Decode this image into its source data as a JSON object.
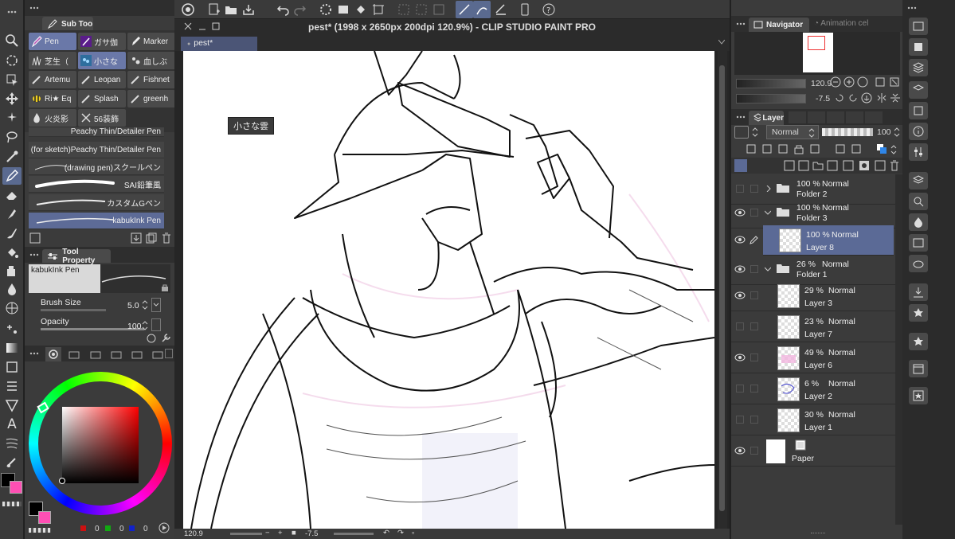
{
  "subtool": {
    "tab_label": "Sub Too",
    "buttons": [
      {
        "label": "Pen"
      },
      {
        "label": "ガサ伽"
      },
      {
        "label": "Marker"
      },
      {
        "label": "芝生（"
      },
      {
        "label": "小さな"
      },
      {
        "label": "血しぶ"
      },
      {
        "label": "Artemu"
      },
      {
        "label": "Leopan"
      },
      {
        "label": "Fishnet"
      },
      {
        "label": "Ri★ Eq"
      },
      {
        "label": "Splash"
      },
      {
        "label": "greenh"
      },
      {
        "label": "火炎影"
      },
      {
        "label": "56装飾"
      }
    ],
    "brushes": [
      {
        "label": "Peachy Thin/Detailer Pen"
      },
      {
        "label": "(for sketch)Peachy Thin/Detailer Pen"
      },
      {
        "label": "(drawing pen)スクールペン"
      },
      {
        "label": "SAI鉛筆風"
      },
      {
        "label": "カスタムGペン"
      },
      {
        "label": "kabukInk Pen"
      }
    ]
  },
  "tool_property": {
    "tab_label": "Tool Property",
    "brush_name": "kabukInk Pen",
    "brush_size_label": "Brush Size",
    "brush_size_value": "5.0",
    "opacity_label": "Opacity",
    "opacity_value": "100"
  },
  "color": {
    "main": "#000000",
    "sub": "#ff4fb4",
    "rgb": [
      "0",
      "0",
      "0"
    ]
  },
  "document": {
    "title": "pest* (1998 x 2650px 200dpi 120.9%)  - CLIP STUDIO PAINT PRO",
    "tab": "pest*",
    "tooltip": "小さな雲"
  },
  "status": {
    "zoom": "120.9",
    "rotation": "-7.5"
  },
  "navigator": {
    "tab_label": "Navigator",
    "tab2_label": "Animation cel",
    "zoom": "120.9",
    "rotation": "-7.5"
  },
  "layers": {
    "tab_label": "Layer",
    "blend": "Normal",
    "opacity": "100",
    "rows": [
      {
        "pct": "100 %",
        "mode": "Normal",
        "name": "Folder 2"
      },
      {
        "pct": "100 %",
        "mode": "Normal",
        "name": "Folder 3"
      },
      {
        "pct": "100 %",
        "mode": "Normal",
        "name": "Layer 8"
      },
      {
        "pct": "26 %",
        "mode": "Normal",
        "name": "Folder 1"
      },
      {
        "pct": "29 %",
        "mode": "Normal",
        "name": "Layer 3"
      },
      {
        "pct": "23 %",
        "mode": "Normal",
        "name": "Layer 7"
      },
      {
        "pct": "49 %",
        "mode": "Normal",
        "name": "Layer 6"
      },
      {
        "pct": "6 %",
        "mode": "Normal",
        "name": "Layer 2"
      },
      {
        "pct": "30 %",
        "mode": "Normal",
        "name": "Layer 1"
      },
      {
        "pct": "",
        "mode": "",
        "name": "Paper"
      }
    ]
  }
}
